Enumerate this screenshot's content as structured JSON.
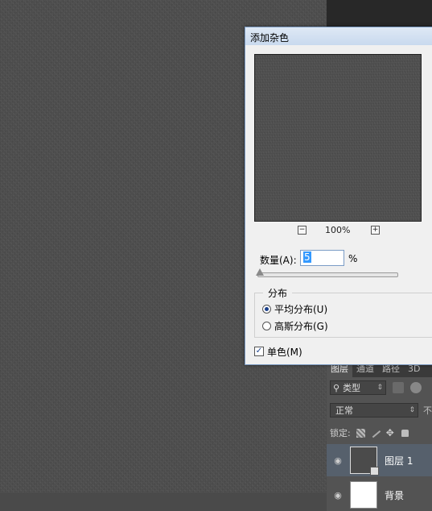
{
  "dialog": {
    "title": "添加杂色",
    "zoom_out_symbol": "−",
    "zoom_in_symbol": "+",
    "zoom_level": "100%",
    "amount_label": "数量(A):",
    "amount_value": "5",
    "amount_unit": "%",
    "amount_slider_fraction": 0.02,
    "distribution_title": "分布",
    "distribution_options": [
      {
        "label": "平均分布(U)",
        "selected": true
      },
      {
        "label": "高斯分布(G)",
        "selected": false
      }
    ],
    "monochromatic_label": "单色(M)",
    "monochromatic_checked": true
  },
  "layers_panel": {
    "tabs": [
      {
        "label": "图层",
        "active": true
      },
      {
        "label": "通道",
        "active": false
      },
      {
        "label": "路径",
        "active": false
      },
      {
        "label": "3D",
        "active": false
      }
    ],
    "filter_icon": "search-icon",
    "filter_kind": "类型",
    "blend_mode": "正常",
    "opacity_label": "不",
    "lock_label": "锁定:",
    "layers": [
      {
        "name": "图层 1",
        "selected": true,
        "visible": true
      },
      {
        "name": "背景",
        "selected": false,
        "visible": true
      }
    ]
  },
  "colors": {
    "canvas_noise_base": "#4c4c4c",
    "dialog_background": "#f0f0f0",
    "selected_layer": "#56606c",
    "text_selection": "#3399ff"
  }
}
